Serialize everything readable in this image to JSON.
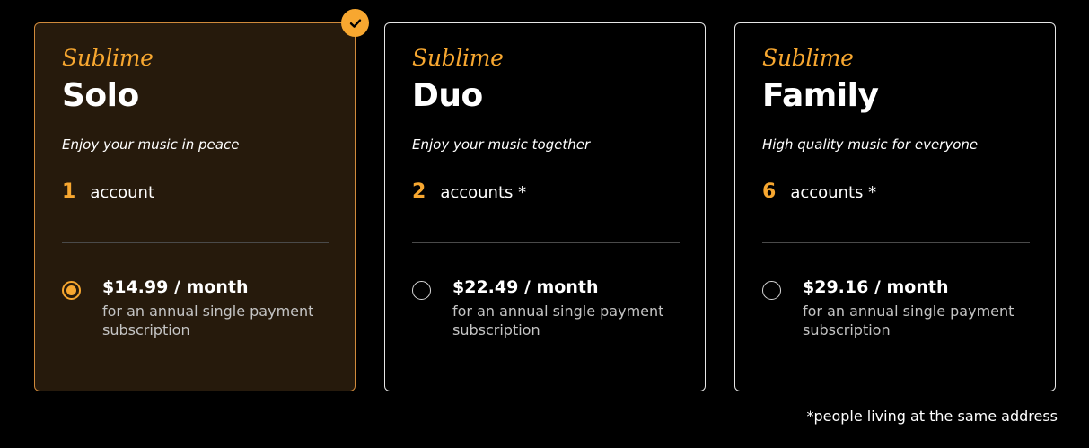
{
  "plans": [
    {
      "brand": "Sublime",
      "name": "Solo",
      "tagline": "Enjoy your music in peace",
      "account_count": "1",
      "account_label": "account",
      "price": "$14.99 / month",
      "price_description": "for an annual single payment subscription",
      "selected": true
    },
    {
      "brand": "Sublime",
      "name": "Duo",
      "tagline": "Enjoy your music together",
      "account_count": "2",
      "account_label": "accounts *",
      "price": "$22.49 / month",
      "price_description": "for an annual single payment subscription",
      "selected": false
    },
    {
      "brand": "Sublime",
      "name": "Family",
      "tagline": "High quality music for everyone",
      "account_count": "6",
      "account_label": "accounts *",
      "price": "$29.16 / month",
      "price_description": "for an annual single payment subscription",
      "selected": false
    }
  ],
  "footnote": "*people living at the same address",
  "icons": {
    "selected_badge": "check-icon"
  },
  "colors": {
    "accent": "#f7a730",
    "background": "#000000",
    "selected_card_background": "#261a0c",
    "selected_card_border": "#d08a3b",
    "card_border": "#e6e6e6",
    "text": "#ffffff",
    "muted_text": "#c4c4c4"
  }
}
